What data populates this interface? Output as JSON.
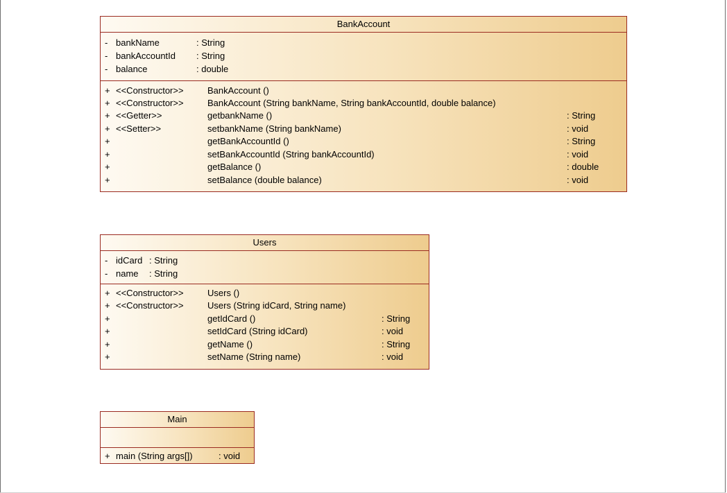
{
  "classes": {
    "bank_account": {
      "name": "BankAccount",
      "attributes": [
        {
          "vis": "-",
          "name": "bankName",
          "type": ": String"
        },
        {
          "vis": "-",
          "name": "bankAccountId",
          "type": ": String"
        },
        {
          "vis": "-",
          "name": "balance",
          "type": ": double"
        }
      ],
      "operations": [
        {
          "vis": "+",
          "stereo": "<<Constructor>>",
          "sig": "BankAccount ()",
          "ret": ""
        },
        {
          "vis": "+",
          "stereo": "<<Constructor>>",
          "sig": "BankAccount (String bankName, String bankAccountId, double balance)",
          "ret": ""
        },
        {
          "vis": "+",
          "stereo": "<<Getter>>",
          "sig": "getbankName ()",
          "ret": ": String"
        },
        {
          "vis": "+",
          "stereo": "<<Setter>>",
          "sig": "setbankName (String bankName)",
          "ret": ": void"
        },
        {
          "vis": "+",
          "stereo": "",
          "sig": "getBankAccountId ()",
          "ret": ": String"
        },
        {
          "vis": "+",
          "stereo": "",
          "sig": "setBankAccountId (String bankAccountId)",
          "ret": ": void"
        },
        {
          "vis": "+",
          "stereo": "",
          "sig": "getBalance ()",
          "ret": ": double"
        },
        {
          "vis": "+",
          "stereo": "",
          "sig": "setBalance (double balance)",
          "ret": ": void"
        }
      ]
    },
    "users": {
      "name": "Users",
      "attributes": [
        {
          "vis": "-",
          "name": "idCard",
          "type": ": String"
        },
        {
          "vis": "-",
          "name": "name",
          "type": ": String"
        }
      ],
      "operations": [
        {
          "vis": "+",
          "stereo": "<<Constructor>>",
          "sig": "Users ()",
          "ret": ""
        },
        {
          "vis": "+",
          "stereo": "<<Constructor>>",
          "sig": "Users (String idCard, String name)",
          "ret": ""
        },
        {
          "vis": "+",
          "stereo": "",
          "sig": "getIdCard ()",
          "ret": ": String"
        },
        {
          "vis": "+",
          "stereo": "",
          "sig": "setIdCard (String idCard)",
          "ret": ": void"
        },
        {
          "vis": "+",
          "stereo": "",
          "sig": "getName ()",
          "ret": ": String"
        },
        {
          "vis": "+",
          "stereo": "",
          "sig": "setName (String name)",
          "ret": ": void"
        }
      ]
    },
    "main": {
      "name": "Main",
      "attributes": [],
      "operations": [
        {
          "vis": "+",
          "sig": "main (String args[])",
          "ret": ": void"
        }
      ]
    }
  }
}
